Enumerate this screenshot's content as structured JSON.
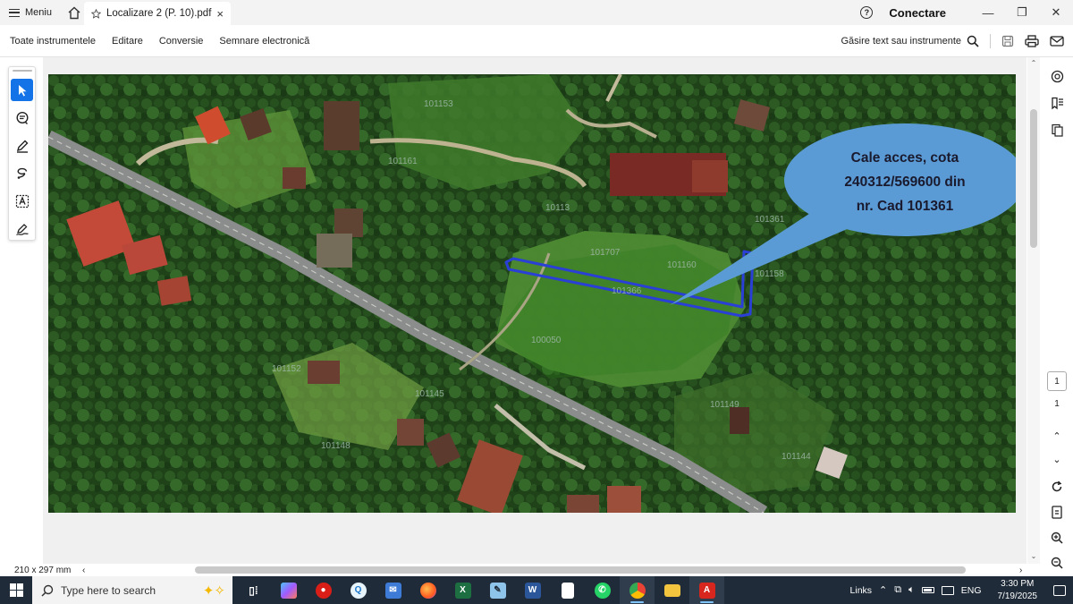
{
  "window": {
    "menu_label": "Meniu",
    "tab_title": "Localizare 2 (P. 10).pdf",
    "tab_close": "×",
    "sign_in": "Conectare",
    "minimize": "—",
    "maximize": "❐",
    "close": "✕"
  },
  "toolbar": {
    "items": [
      "Toate instrumentele",
      "Editare",
      "Conversie",
      "Semnare electronică"
    ],
    "find_label": "Găsire text sau instrumente"
  },
  "document": {
    "callout_lines": [
      "Cale acces, cota",
      "240312/569600 din",
      "nr. Cad 101361"
    ],
    "parcel_labels": [
      "101153",
      "101161",
      "10113",
      "101707",
      "101160",
      "101158",
      "100050",
      "101366",
      "101361",
      "101152",
      "101145",
      "101148",
      "101149",
      "101144"
    ],
    "colors": {
      "callout_fill": "#5b9bd5",
      "callout_text": "#1a1a2e",
      "access_path": "#2a3fd6"
    }
  },
  "navigation": {
    "current_page": "1",
    "total_pages": "1"
  },
  "status": {
    "page_size": "210 x 297 mm"
  },
  "taskbar": {
    "search_placeholder": "Type here to search",
    "links": "Links",
    "lang": "ENG",
    "time": "3:30 PM",
    "date": "7/19/2025",
    "apps": [
      {
        "name": "task-view",
        "color": "#1f2b38",
        "glyph": "▮▮"
      },
      {
        "name": "copilot",
        "color": "#7a5cff",
        "glyph": "◆"
      },
      {
        "name": "app-red",
        "color": "#d91e18",
        "glyph": "●"
      },
      {
        "name": "app-cyan",
        "color": "#1ba1e2",
        "glyph": "Q"
      },
      {
        "name": "app-mail",
        "color": "#3d7bd6",
        "glyph": "✉"
      },
      {
        "name": "firefox",
        "color": "#ff6a00",
        "glyph": "●"
      },
      {
        "name": "excel",
        "color": "#1d6f42",
        "glyph": "X"
      },
      {
        "name": "app-notepad",
        "color": "#5aa0d8",
        "glyph": "✎"
      },
      {
        "name": "word",
        "color": "#2b579a",
        "glyph": "W"
      },
      {
        "name": "app-doc",
        "color": "#ffffff",
        "glyph": ""
      },
      {
        "name": "whatsapp",
        "color": "#25d366",
        "glyph": "✆"
      },
      {
        "name": "chrome",
        "color": "#e8453c",
        "glyph": "◉"
      },
      {
        "name": "file-explorer",
        "color": "#f3c53e",
        "glyph": "▭"
      },
      {
        "name": "acrobat",
        "color": "#d7261e",
        "glyph": "A"
      }
    ]
  }
}
